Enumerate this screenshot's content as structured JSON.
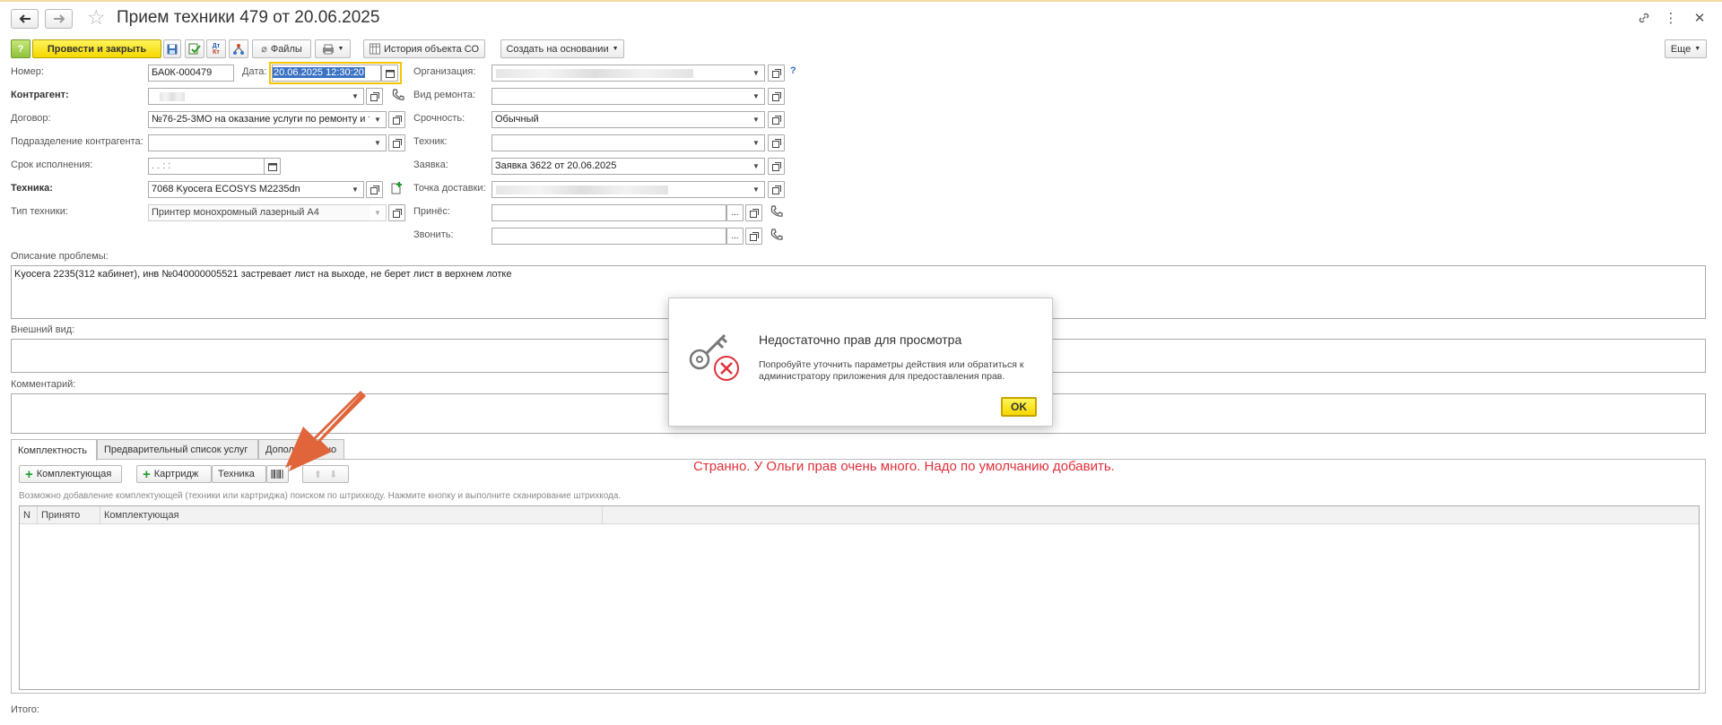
{
  "header": {
    "title": "Прием техники 479 от 20.06.2025"
  },
  "toolbar": {
    "post_close": "Провести и закрыть",
    "files": "Файлы",
    "history": "История объекта СО",
    "create_based": "Создать на основании",
    "more": "Еще"
  },
  "form": {
    "number_label": "Номер:",
    "number_value": "БА0К-000479",
    "date_label": "Дата:",
    "date_value": "20.06.2025 12:30:20",
    "org_label": "Организация:",
    "org_help": "?",
    "counterparty_label": "Контрагент:",
    "repair_type_label": "Вид ремонта:",
    "contract_label": "Договор:",
    "contract_value": "№76-25-3МО на оказание услуги по ремонту и т",
    "urgency_label": "Срочность:",
    "urgency_value": "Обычный",
    "subdivision_label": "Подразделение контрагента:",
    "technician_label": "Техник:",
    "deadline_label": "Срок исполнения:",
    "deadline_value": " .  .       :  :",
    "request_label": "Заявка:",
    "request_value": "Заявка 3622 от 20.06.2025",
    "equipment_label": "Техника:",
    "equipment_value": "7068 Kyocera ECOSYS M2235dn",
    "delivery_label": "Точка доставки:",
    "equip_type_label": "Тип техники:",
    "equip_type_value": "Принтер монохромный лазерный А4",
    "brought_label": "Принёс:",
    "call_label": "Звонить:",
    "problem_label": "Описание проблемы:",
    "problem_value": "Kyocera 2235(312 кабинет), инв №040000005521 застревает лист на выходе, не берет лист в верхнем лотке",
    "appearance_label": "Внешний вид:",
    "comment_label": "Комментарий:",
    "total_label": "Итого:",
    "ellipsis": "..."
  },
  "tabs": [
    {
      "label": "Комплектность"
    },
    {
      "label": "Предварительный список услуг"
    },
    {
      "label": "Дополнительно"
    }
  ],
  "tab_panel": {
    "add_component": "Комплектующая",
    "add_cartridge": "Картридж",
    "equipment_btn": "Техника",
    "hint": "Возможно добавление комплектующей (техники или картриджа) поиском по штрихкоду. Нажмите кнопку и выполните сканирование штрихкода.",
    "columns": [
      "N",
      "Принято",
      "Комплектующая"
    ]
  },
  "annotation": {
    "note": "Странно. У Ольги прав очень много. Надо по умолчанию добавить.",
    "color": "#e0303a",
    "arrow_color": "#e0653a"
  },
  "dialog": {
    "title": "Недостаточно прав для просмотра",
    "message": "Попробуйте уточнить параметры действия или обратиться к администратору приложения для предоставления прав.",
    "ok": "OK"
  }
}
